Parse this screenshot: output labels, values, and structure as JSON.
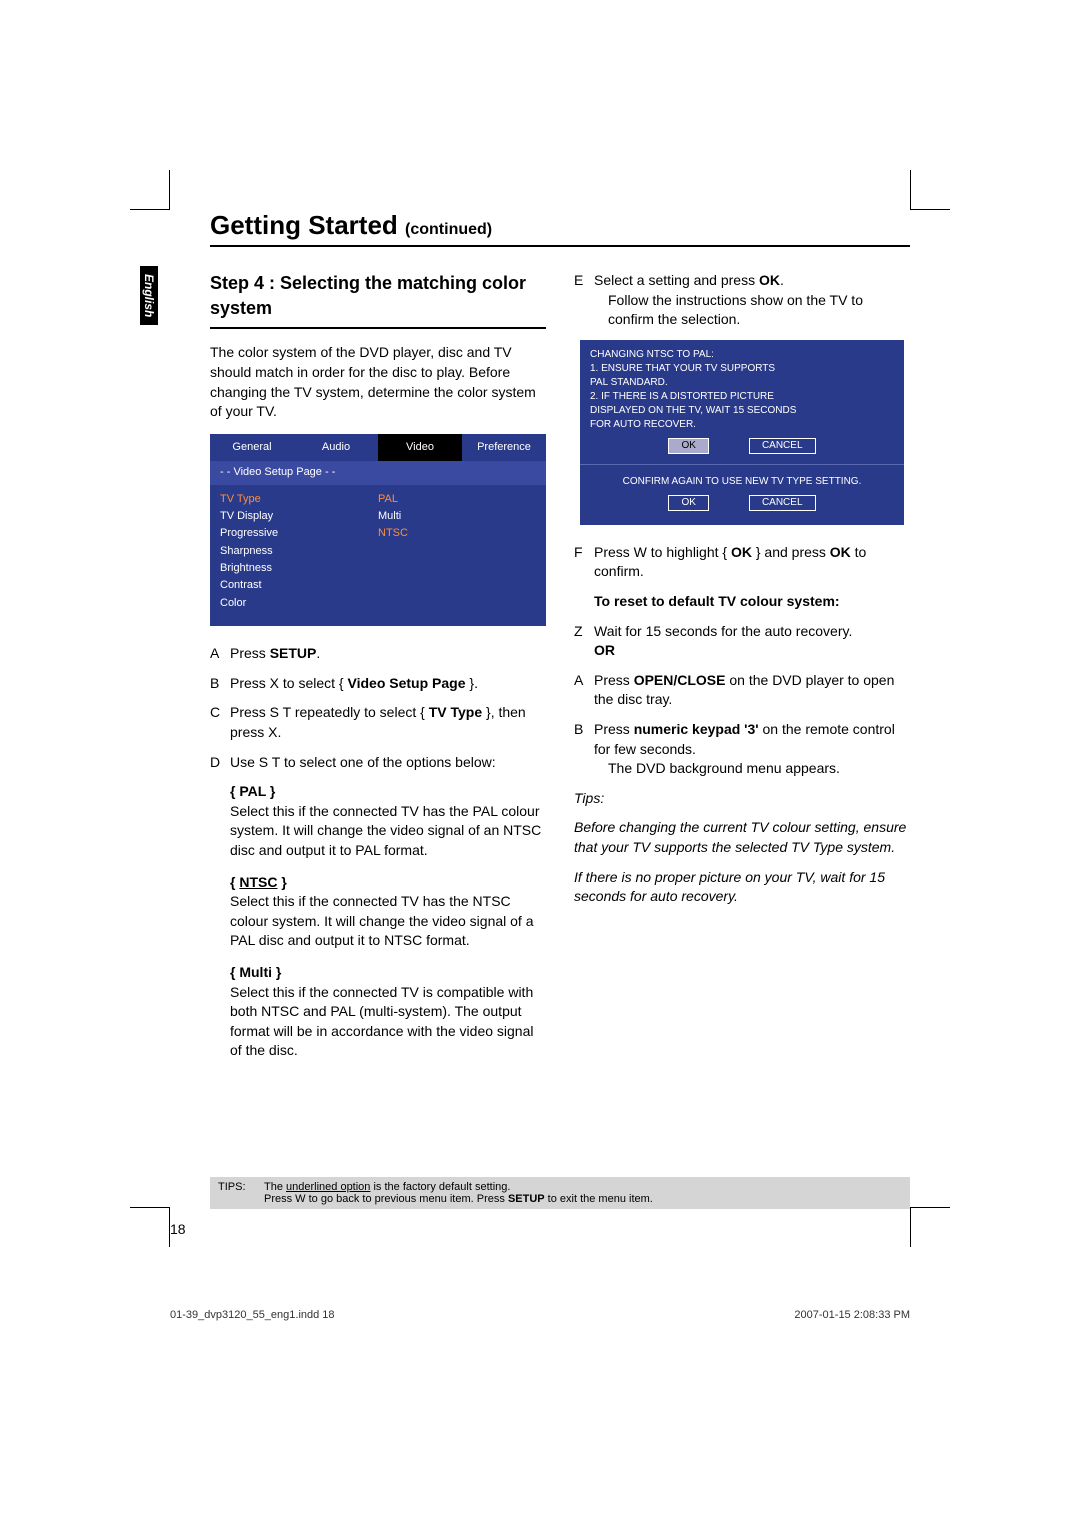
{
  "page": {
    "title_main": "Getting Started ",
    "title_cont": "(continued)",
    "language_tab": "English",
    "page_number": "18"
  },
  "step": {
    "heading": "Step 4 : Selecting the matching color system",
    "intro": "The color system of the DVD player, disc and TV should match in order for the disc to play. Before changing the TV system, determine the color system of your TV."
  },
  "setup_menu": {
    "tabs": [
      "General",
      "Audio",
      "Video",
      "Preference"
    ],
    "subhead": "- -   Video Setup Page   - -",
    "rows": [
      {
        "label": "TV Type",
        "value": "PAL",
        "highlight_label": true
      },
      {
        "label": "TV Display",
        "value": "Multi"
      },
      {
        "label": "Progressive",
        "value": "NTSC",
        "highlight_value": true
      },
      {
        "label": "Sharpness",
        "value": ""
      },
      {
        "label": "Brightness",
        "value": ""
      },
      {
        "label": "Contrast",
        "value": ""
      },
      {
        "label": "Color",
        "value": ""
      }
    ]
  },
  "left_steps": {
    "a": "Press ",
    "a_bold": "SETUP",
    "a_end": ".",
    "b": "Press  X to select { ",
    "b_bold": "Video Setup Page",
    "b_end": " }.",
    "c_pre": "Press  S  T repeatedly to select { ",
    "c_bold": "TV Type",
    "c_end": " }, then press  X.",
    "d": "Use  S  T to select one of the options below:"
  },
  "options": {
    "pal_label": "{ PAL }",
    "pal_text": "Select this if the connected TV has the PAL colour system. It will change the video signal of an NTSC disc and output it to PAL format.",
    "ntsc_label": "{ NTSC }",
    "ntsc_text": "Select this if the connected TV has the NTSC colour system. It will change the video signal of a PAL disc and output it to NTSC format.",
    "multi_label": "{ Multi }",
    "multi_text": "Select this if the connected TV is compatible with both NTSC and PAL (multi-system). The output format will be in accordance with the video signal of the disc."
  },
  "right": {
    "e_text": "Select a setting and press ",
    "e_bold": "OK",
    "e_end": ".",
    "e_sub": "Follow the instructions show on the TV to confirm the selection.",
    "f_text": "Press  W to highlight { ",
    "f_bold": "OK",
    "f_mid": " } and press ",
    "f_bold2": "OK",
    "f_end": " to confirm.",
    "reset_heading": "To reset to default TV colour system:",
    "z": "Wait for 15 seconds for the auto recovery.",
    "or": "OR",
    "a2_pre": "Press ",
    "a2_bold": "OPEN/CLOSE",
    "a2_end": "       on the DVD player to open the disc tray.",
    "b2_pre": "Press ",
    "b2_bold": "numeric keypad '3'",
    "b2_end": " on the remote control for few seconds.",
    "b2_sub": "The DVD background menu appears.",
    "tips_heading": "Tips:",
    "tips1": "  Before changing the current TV colour setting, ensure that your TV supports the  selected TV Type  system.",
    "tips2": "  If there is no proper picture on your TV, wait for 15 seconds for auto recovery."
  },
  "dialog": {
    "line1": "CHANGING NTSC TO PAL:",
    "line2": "1. ENSURE THAT YOUR TV SUPPORTS",
    "line3": "    PAL STANDARD.",
    "line4": "2. IF THERE IS A DISTORTED PICTURE",
    "line5": "    DISPLAYED ON THE TV, WAIT 15 SECONDS",
    "line6": "    FOR AUTO RECOVER.",
    "ok": "OK",
    "cancel": "CANCEL",
    "confirm": "CONFIRM AGAIN TO USE NEW TV TYPE SETTING."
  },
  "footer_tips": {
    "label": "TIPS:",
    "line1a": "The ",
    "line1_underline": "underlined option",
    "line1b": " is the factory default setting.",
    "line2": "Press  W to go back to previous menu item. Press ",
    "line2_bold": "SETUP",
    "line2_end": " to exit the menu item."
  },
  "meta": {
    "left": "01-39_dvp3120_55_eng1.indd   18",
    "right": "2007-01-15   2:08:33 PM"
  }
}
